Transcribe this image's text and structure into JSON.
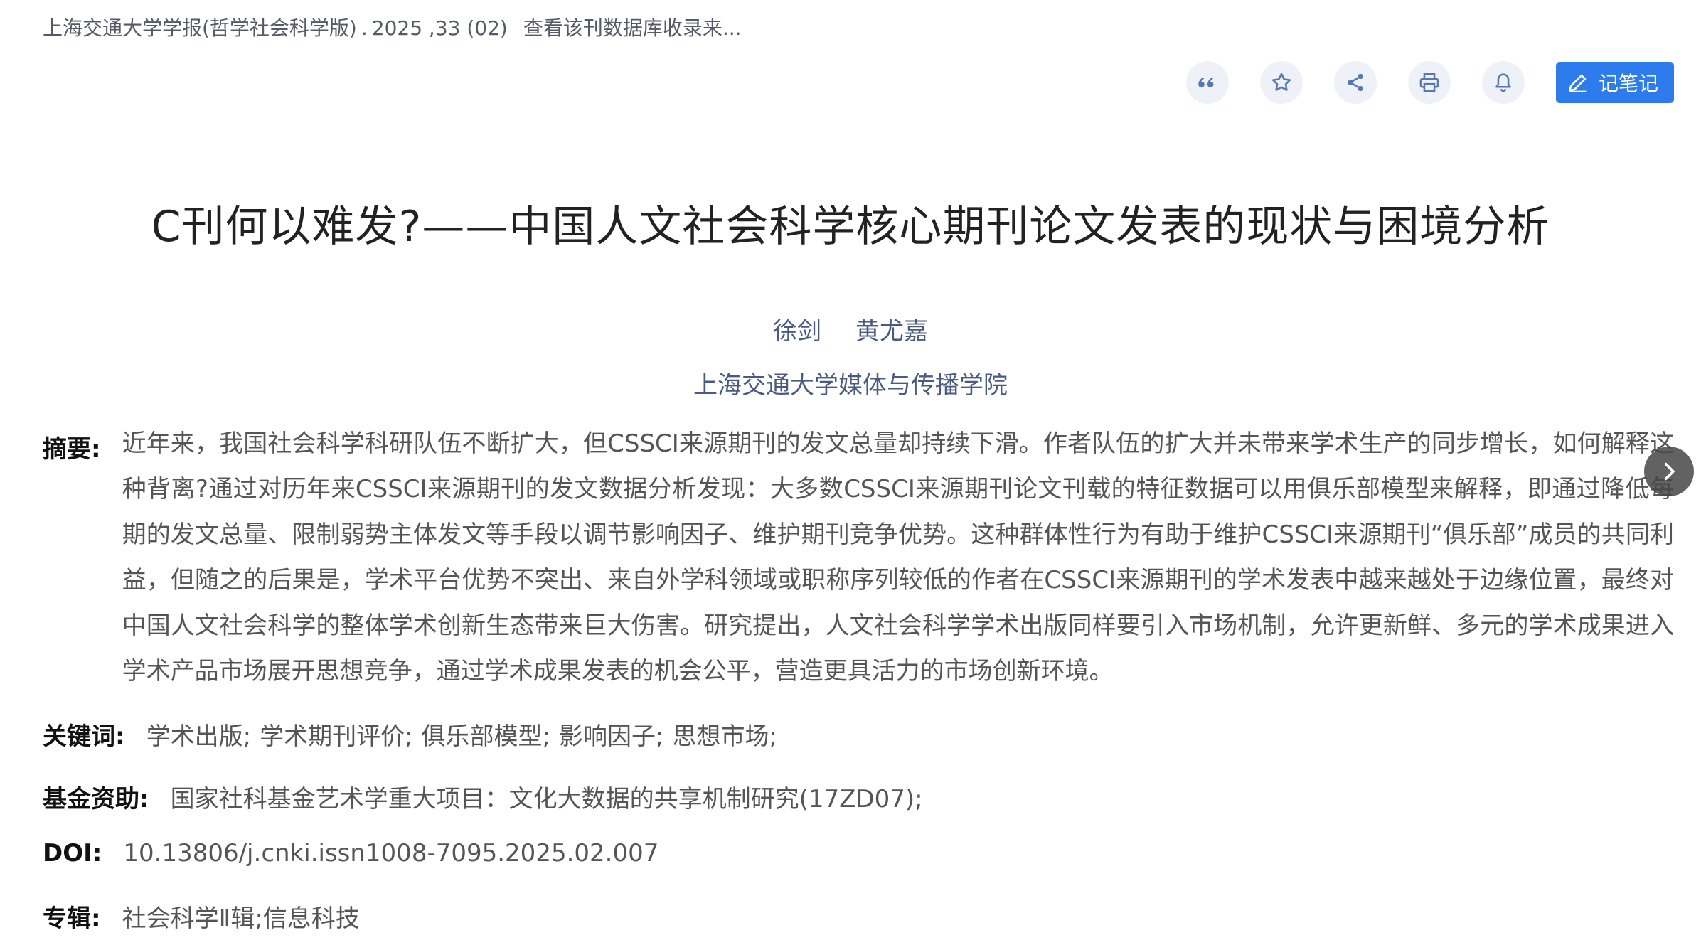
{
  "source": {
    "journal": "上海交通大学学报(哲学社会科学版)",
    "sep": ".",
    "issue": "2025 ,33 (02)",
    "db_link": "查看该刊数据库收录来..."
  },
  "toolbar": {
    "icons": [
      "quote-icon",
      "star-icon",
      "share-icon",
      "print-icon",
      "bell-icon"
    ],
    "note_label": "记笔记"
  },
  "article": {
    "title": "C刊何以难发?——中国人文社会科学核心期刊论文发表的现状与困境分析",
    "authors": [
      "徐剑",
      "黄尤嘉"
    ],
    "affiliation": "上海交通大学媒体与传播学院"
  },
  "abstract": {
    "label": "摘要:",
    "text": "近年来，我国社会科学科研队伍不断扩大，但CSSCI来源期刊的发文总量却持续下滑。作者队伍的扩大并未带来学术生产的同步增长，如何解释这种背离?通过对历年来CSSCI来源期刊的发文数据分析发现：大多数CSSCI来源期刊论文刊载的特征数据可以用俱乐部模型来解释，即通过降低每期的发文总量、限制弱势主体发文等手段以调节影响因子、维护期刊竞争优势。这种群体性行为有助于维护CSSCI来源期刊“俱乐部”成员的共同利益，但随之的后果是，学术平台优势不突出、来自外学科领域或职称序列较低的作者在CSSCI来源期刊的学术发表中越来越处于边缘位置，最终对中国人文社会科学的整体学术创新生态带来巨大伤害。研究提出，人文社会科学学术出版同样要引入市场机制，允许更新鲜、多元的学术成果进入学术产品市场展开思想竞争，通过学术成果发表的机会公平，营造更具活力的市场创新环境。"
  },
  "keywords": {
    "label": "关键词:",
    "items": [
      "学术出版;",
      "学术期刊评价;",
      "俱乐部模型;",
      "影响因子;",
      "思想市场;"
    ]
  },
  "fund": {
    "label": "基金资助:",
    "value": "国家社科基金艺术学重大项目：文化大数据的共享机制研究(17ZD07);"
  },
  "doi": {
    "label": "DOI:",
    "value": "10.13806/j.cnki.issn1008-7095.2025.02.007"
  },
  "album": {
    "label": "专辑:",
    "value": "社会科学Ⅱ辑;信息科技"
  },
  "colors": {
    "accent": "#2d7bec",
    "icon_bg": "#eef2f8",
    "author": "#4a5a80"
  }
}
